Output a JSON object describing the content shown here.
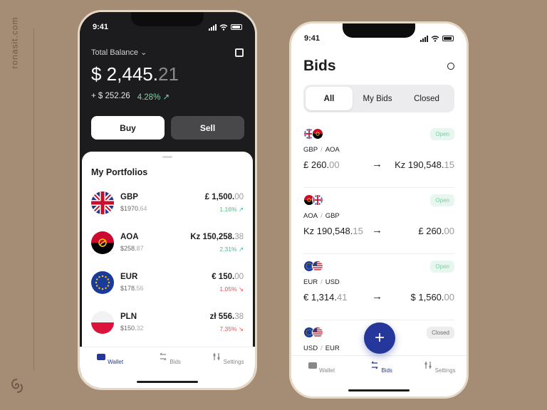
{
  "brand": "ronasit.com",
  "wallet": {
    "status_time": "9:41",
    "total_label": "Total Balance",
    "balance_main": "$ 2,445.",
    "balance_frac": "21",
    "change_amount": "+ $ 252.26",
    "change_pct": "4.28%",
    "buy_label": "Buy",
    "sell_label": "Sell",
    "portfolios_title": "My Portfolios",
    "portfolios": [
      {
        "code": "GBP",
        "sub_main": "$1970.",
        "sub_frac": "64",
        "amt_main": "£ 1,500.",
        "amt_frac": "00",
        "pct": "1.16%",
        "dir": "up"
      },
      {
        "code": "AOA",
        "sub_main": "$258.",
        "sub_frac": "87",
        "amt_main": "Kz 150,258.",
        "amt_frac": "38",
        "pct": "2.31%",
        "dir": "up"
      },
      {
        "code": "EUR",
        "sub_main": "$178.",
        "sub_frac": "56",
        "amt_main": "€ 150.",
        "amt_frac": "00",
        "pct": "1.05%",
        "dir": "down"
      },
      {
        "code": "PLN",
        "sub_main": "$150.",
        "sub_frac": "32",
        "amt_main": "zł 556.",
        "amt_frac": "38",
        "pct": "7.35%",
        "dir": "down"
      }
    ],
    "tabs": [
      "Wallet",
      "Bids",
      "Settings"
    ]
  },
  "bids": {
    "status_time": "9:41",
    "title": "Bids",
    "segments": [
      "All",
      "My Bids",
      "Closed"
    ],
    "items": [
      {
        "from": "GBP",
        "to": "AOA",
        "status": "Open",
        "left_main": "£ 260.",
        "left_frac": "00",
        "right_main": "Kz 190,548.",
        "right_frac": "15"
      },
      {
        "from": "AOA",
        "to": "GBP",
        "status": "Open",
        "left_main": "Kz 190,548.",
        "left_frac": "15",
        "right_main": "£ 260.",
        "right_frac": "00"
      },
      {
        "from": "EUR",
        "to": "USD",
        "status": "Open",
        "left_main": "€ 1,314.",
        "left_frac": "41",
        "right_main": "$ 1,560.",
        "right_frac": "00"
      },
      {
        "from": "USD",
        "to": "EUR",
        "status": "Closed"
      }
    ],
    "tabs": [
      "Wallet",
      "Bids",
      "Settings"
    ],
    "fab_label": "+"
  },
  "colors": {
    "accent": "#26379b",
    "up": "#4fb886",
    "down": "#e05656",
    "background": "#a58c74"
  }
}
